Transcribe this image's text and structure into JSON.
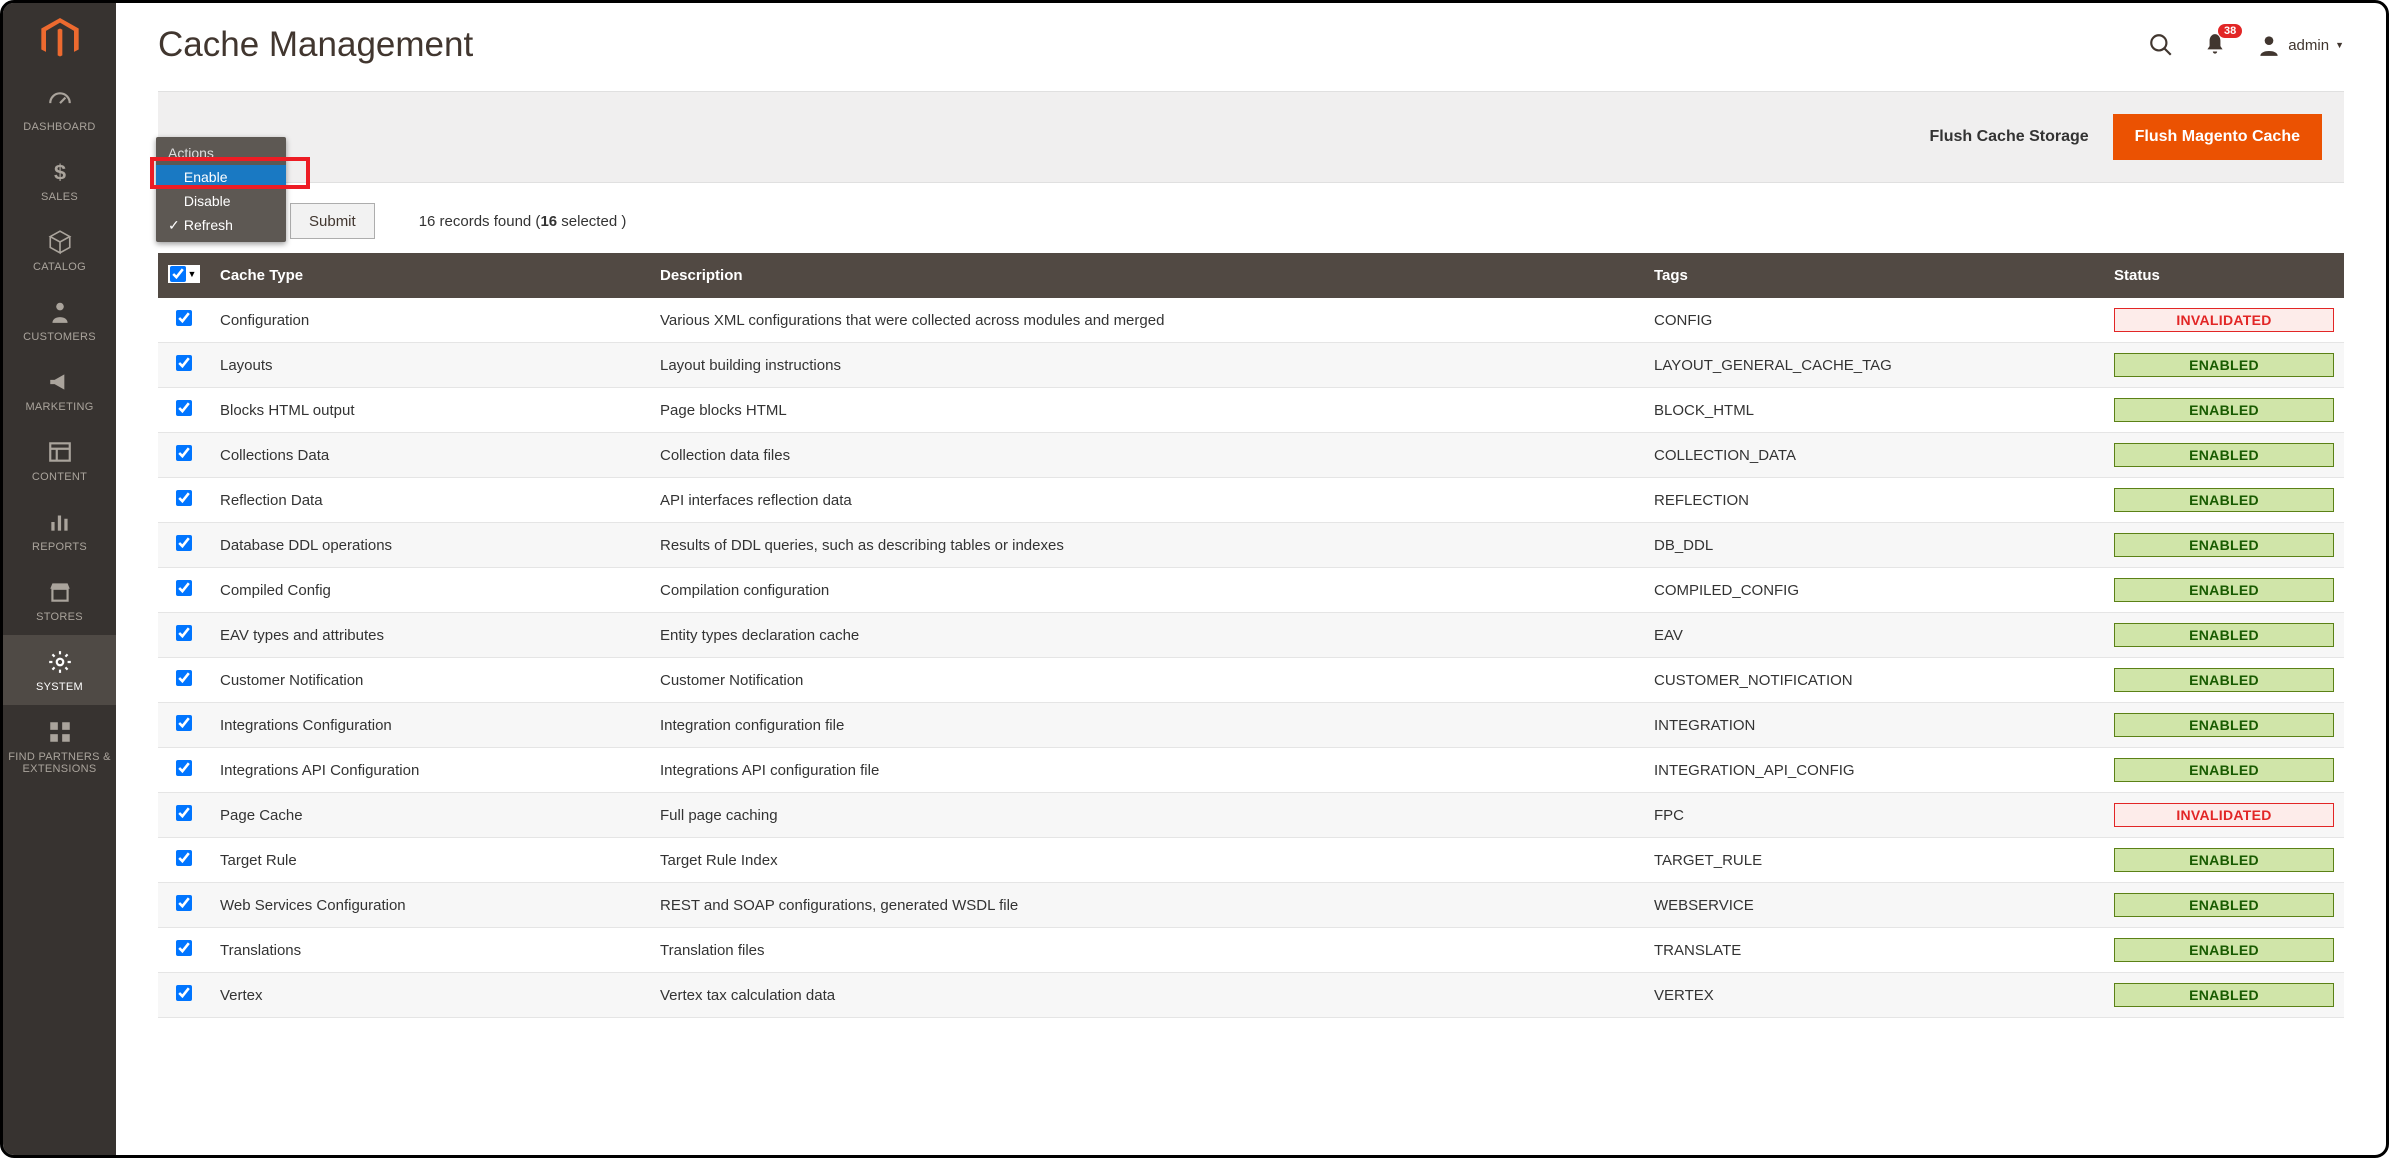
{
  "header": {
    "page_title": "Cache Management",
    "notif_count": "38",
    "admin_label": "admin"
  },
  "sidebar": {
    "items": [
      {
        "label": "DASHBOARD",
        "icon": "dashboard-icon"
      },
      {
        "label": "SALES",
        "icon": "dollar-icon"
      },
      {
        "label": "CATALOG",
        "icon": "cube-icon"
      },
      {
        "label": "CUSTOMERS",
        "icon": "person-icon"
      },
      {
        "label": "MARKETING",
        "icon": "megaphone-icon"
      },
      {
        "label": "CONTENT",
        "icon": "layout-icon"
      },
      {
        "label": "REPORTS",
        "icon": "bars-icon"
      },
      {
        "label": "STORES",
        "icon": "storefront-icon"
      },
      {
        "label": "SYSTEM",
        "icon": "gear-icon"
      },
      {
        "label": "FIND PARTNERS & EXTENSIONS",
        "icon": "blocks-icon"
      }
    ],
    "active_index": 8
  },
  "action_bar": {
    "flush_storage": "Flush Cache Storage",
    "flush_magento": "Flush Magento Cache"
  },
  "dropdown": {
    "title": "Actions",
    "items": [
      "Enable",
      "Disable",
      "Refresh"
    ],
    "hover_index": 0,
    "checked_index": 2
  },
  "controls": {
    "submit": "Submit",
    "records_found_prefix": "16 records found (",
    "records_found_bold": "16",
    "records_found_suffix": " selected )"
  },
  "table": {
    "columns": [
      "Cache Type",
      "Description",
      "Tags",
      "Status"
    ],
    "status_labels": {
      "enabled": "ENABLED",
      "invalidated": "INVALIDATED"
    },
    "rows": [
      {
        "type": "Configuration",
        "desc": "Various XML configurations that were collected across modules and merged",
        "tags": "CONFIG",
        "status": "invalidated"
      },
      {
        "type": "Layouts",
        "desc": "Layout building instructions",
        "tags": "LAYOUT_GENERAL_CACHE_TAG",
        "status": "enabled"
      },
      {
        "type": "Blocks HTML output",
        "desc": "Page blocks HTML",
        "tags": "BLOCK_HTML",
        "status": "enabled"
      },
      {
        "type": "Collections Data",
        "desc": "Collection data files",
        "tags": "COLLECTION_DATA",
        "status": "enabled"
      },
      {
        "type": "Reflection Data",
        "desc": "API interfaces reflection data",
        "tags": "REFLECTION",
        "status": "enabled"
      },
      {
        "type": "Database DDL operations",
        "desc": "Results of DDL queries, such as describing tables or indexes",
        "tags": "DB_DDL",
        "status": "enabled"
      },
      {
        "type": "Compiled Config",
        "desc": "Compilation configuration",
        "tags": "COMPILED_CONFIG",
        "status": "enabled"
      },
      {
        "type": "EAV types and attributes",
        "desc": "Entity types declaration cache",
        "tags": "EAV",
        "status": "enabled"
      },
      {
        "type": "Customer Notification",
        "desc": "Customer Notification",
        "tags": "CUSTOMER_NOTIFICATION",
        "status": "enabled"
      },
      {
        "type": "Integrations Configuration",
        "desc": "Integration configuration file",
        "tags": "INTEGRATION",
        "status": "enabled"
      },
      {
        "type": "Integrations API Configuration",
        "desc": "Integrations API configuration file",
        "tags": "INTEGRATION_API_CONFIG",
        "status": "enabled"
      },
      {
        "type": "Page Cache",
        "desc": "Full page caching",
        "tags": "FPC",
        "status": "invalidated"
      },
      {
        "type": "Target Rule",
        "desc": "Target Rule Index",
        "tags": "TARGET_RULE",
        "status": "enabled"
      },
      {
        "type": "Web Services Configuration",
        "desc": "REST and SOAP configurations, generated WSDL file",
        "tags": "WEBSERVICE",
        "status": "enabled"
      },
      {
        "type": "Translations",
        "desc": "Translation files",
        "tags": "TRANSLATE",
        "status": "enabled"
      },
      {
        "type": "Vertex",
        "desc": "Vertex tax calculation data",
        "tags": "VERTEX",
        "status": "enabled"
      }
    ]
  }
}
